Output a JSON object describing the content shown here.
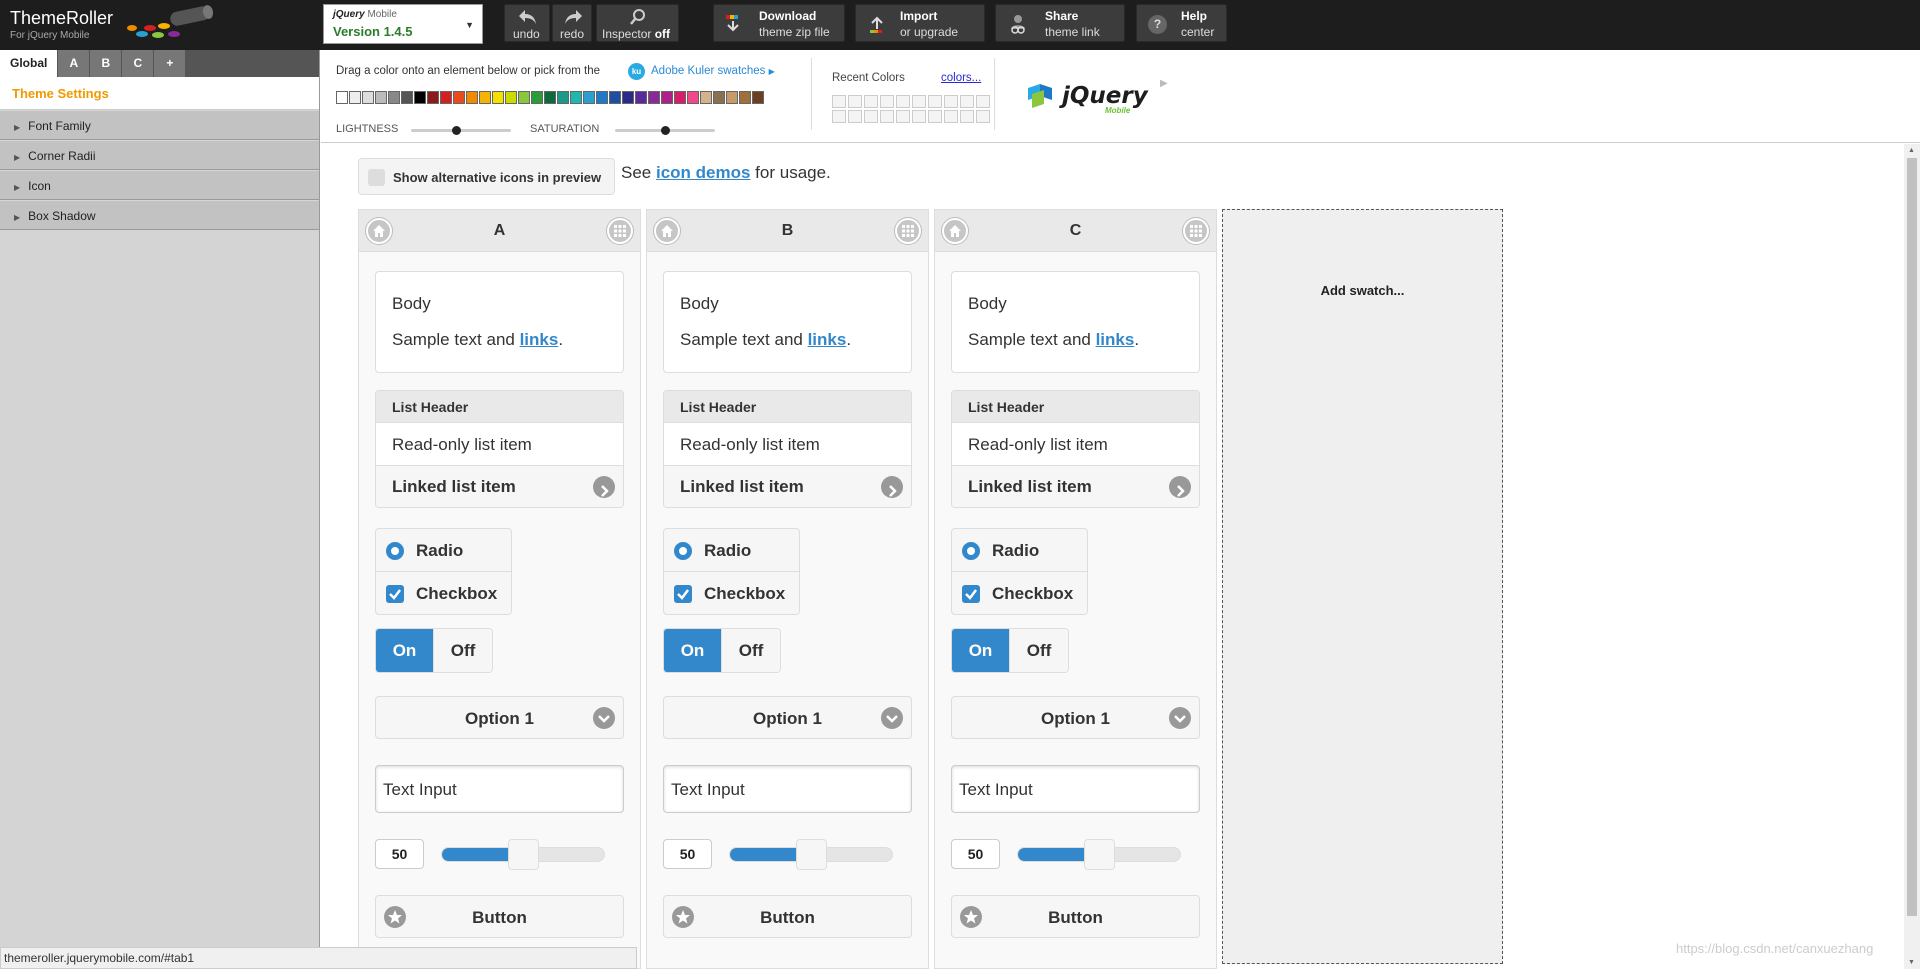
{
  "app": {
    "title": "ThemeRoller",
    "subtitle": "For jQuery Mobile",
    "version_logo": "jQuery",
    "version_logo_suffix": "Mobile",
    "version_label": "Version 1.4.5"
  },
  "toolbar": {
    "undo": "undo",
    "redo": "redo",
    "inspector": "Inspector",
    "inspector_state": "off",
    "download_title": "Download",
    "download_sub": "theme zip file",
    "import_title": "Import",
    "import_sub": "or upgrade",
    "share_title": "Share",
    "share_sub": "theme link",
    "help_title": "Help",
    "help_sub": "center"
  },
  "left_tabs": [
    "Global",
    "A",
    "B",
    "C",
    "+"
  ],
  "theme_settings_label": "Theme Settings",
  "accordion": [
    "Font Family",
    "Corner Radii",
    "Icon",
    "Box Shadow"
  ],
  "color_panel": {
    "instructions": "Drag a color onto an element below or pick from the",
    "kuler_icon": "ku",
    "kuler_link": "Adobe Kuler swatches",
    "lightness_label": "LIGHTNESS",
    "saturation_label": "SATURATION",
    "lightness_value": 0.45,
    "saturation_value": 0.5,
    "recent_label": "Recent Colors",
    "colors_link": "colors...",
    "swatch_colors": [
      "#ffffff",
      "#eeeeee",
      "#dddddd",
      "#bbbbbb",
      "#888888",
      "#555555",
      "#000000",
      "#8b1a1a",
      "#d42020",
      "#e84c1c",
      "#f08a00",
      "#f5b400",
      "#f5e000",
      "#c8dc00",
      "#8cc63f",
      "#2a9d3a",
      "#0c6b3a",
      "#1a9a8a",
      "#1fb8b0",
      "#28a0d0",
      "#1e7ac8",
      "#1e4fa0",
      "#2a2a8a",
      "#5a2a9a",
      "#8a2a9a",
      "#b0208a",
      "#d81e6a",
      "#f04a8a",
      "#d4b28c",
      "#8a7050",
      "#c89a6a",
      "#a0703a",
      "#6a4020"
    ]
  },
  "alt_icons_label": "Show alternative icons in preview",
  "see_prefix": "See ",
  "see_link": "icon demos",
  "see_suffix": " for usage.",
  "swatches": [
    {
      "name": "A",
      "body": "Body",
      "sample_prefix": "Sample text and ",
      "sample_link": "links",
      "sample_suffix": ".",
      "list_header": "List Header",
      "list_readonly": "Read-only list item",
      "list_linked": "Linked list item",
      "radio": "Radio",
      "checkbox": "Checkbox",
      "flip_on": "On",
      "flip_off": "Off",
      "select": "Option 1",
      "text_input": "Text Input",
      "slider_value": "50",
      "button": "Button"
    },
    {
      "name": "B",
      "body": "Body",
      "sample_prefix": "Sample text and ",
      "sample_link": "links",
      "sample_suffix": ".",
      "list_header": "List Header",
      "list_readonly": "Read-only list item",
      "list_linked": "Linked list item",
      "radio": "Radio",
      "checkbox": "Checkbox",
      "flip_on": "On",
      "flip_off": "Off",
      "select": "Option 1",
      "text_input": "Text Input",
      "slider_value": "50",
      "button": "Button"
    },
    {
      "name": "C",
      "body": "Body",
      "sample_prefix": "Sample text and ",
      "sample_link": "links",
      "sample_suffix": ".",
      "list_header": "List Header",
      "list_readonly": "Read-only list item",
      "list_linked": "Linked list item",
      "radio": "Radio",
      "checkbox": "Checkbox",
      "flip_on": "On",
      "flip_off": "Off",
      "select": "Option 1",
      "text_input": "Text Input",
      "slider_value": "50",
      "button": "Button"
    }
  ],
  "add_swatch": "Add swatch...",
  "status_url": "themeroller.jquerymobile.com/#tab1",
  "watermark": "https://blog.csdn.net/canxuezhang",
  "colors": {
    "accent": "#3388cc",
    "theme_settings": "#f09a00",
    "version_green": "#2a7d2a"
  }
}
